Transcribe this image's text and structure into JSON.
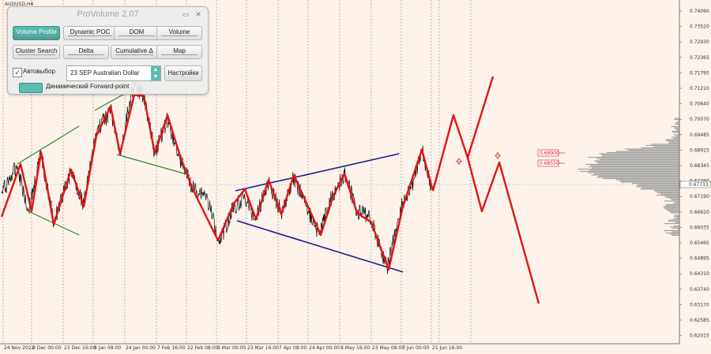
{
  "symbol_label": "AUDUSD,H4",
  "panel": {
    "title": "ProVolume 2.07",
    "window_controls": [
      "▭",
      "✕"
    ],
    "buttons": [
      {
        "label": "Volume Profile",
        "active": true
      },
      {
        "label": "Dynamic POC",
        "active": false
      },
      {
        "label": "DOM",
        "active": false
      },
      {
        "label": "Volume",
        "active": false
      },
      {
        "label": "Cluster Search",
        "active": false
      },
      {
        "label": "Delta",
        "active": false
      },
      {
        "label": "Cumulative Δ",
        "active": false
      },
      {
        "label": "Map",
        "active": false
      }
    ],
    "checkbox_label": "Автовыбор",
    "checkbox_checked": true,
    "symbol_select_value": "23 SEP Australian Dollar",
    "settings_label": "Настройки",
    "toggle_label": "Динамический Forward-point"
  },
  "price_axis": {
    "labels": [
      "0.74090",
      "0.73520",
      "0.72930",
      "0.72365",
      "0.71795",
      "0.71210",
      "0.70640",
      "0.70070",
      "0.69485",
      "0.68915",
      "0.68345",
      "0.67760",
      "0.67190",
      "0.66620",
      "0.66035",
      "0.65465",
      "0.64895",
      "0.64310",
      "0.63740",
      "0.63170",
      "0.62585",
      "0.62015"
    ],
    "current_price": "0.67733",
    "level_tags": [
      "0.68900",
      "0.68550"
    ]
  },
  "time_axis": {
    "labels": [
      "24 Nov 2022",
      "9 Dec 00:00",
      "23 Dec 16:00",
      "9 Jan 08:00",
      "24 Jan 00:00",
      "7 Feb 16:00",
      "22 Feb 08:00",
      "9 Mar 00:00",
      "23 Mar 16:00",
      "7 Apr 08:00",
      "24 Apr 00:00",
      "8 May 16:00",
      "23 May 08:00",
      "7 Jun 00:00",
      "21 Jun 16:00"
    ]
  },
  "colors": {
    "background": "#fdf3ea",
    "zigzag": "#e01414",
    "channel_green": "#2a8a2a",
    "channel_blue": "#1a1a8c",
    "volume_profile": "#9a9a9a",
    "accent": "#4fb0a5"
  }
}
